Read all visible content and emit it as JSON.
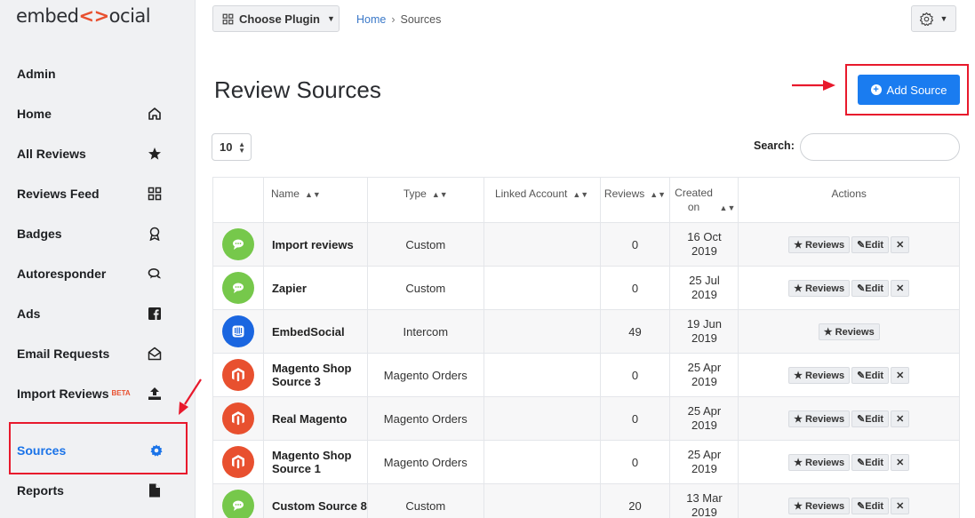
{
  "logo": {
    "left": "embed",
    "bracket": "<>",
    "right": "ocial"
  },
  "sidebar": {
    "items": [
      {
        "label": "Admin",
        "icon": ""
      },
      {
        "label": "Home",
        "icon": "home-icon"
      },
      {
        "label": "All Reviews",
        "icon": "star-icon"
      },
      {
        "label": "Reviews Feed",
        "icon": "grid-icon"
      },
      {
        "label": "Badges",
        "icon": "badge-icon"
      },
      {
        "label": "Autoresponder",
        "icon": "chat-icon"
      },
      {
        "label": "Ads",
        "icon": "facebook-icon"
      },
      {
        "label": "Email Requests",
        "icon": "envelope-icon"
      },
      {
        "label": "Import Reviews",
        "badge": "BETA",
        "icon": "upload-icon"
      },
      {
        "label": "Sources",
        "icon": "gear-icon",
        "active": true
      },
      {
        "label": "Reports",
        "icon": "file-icon"
      }
    ]
  },
  "topbar": {
    "plugin_label": "Choose Plugin",
    "breadcrumb": {
      "home": "Home",
      "sep": "›",
      "current": "Sources"
    }
  },
  "page": {
    "title": "Review Sources"
  },
  "add_button": {
    "label": "Add Source"
  },
  "table_controls": {
    "page_length": "10",
    "search_label": "Search:"
  },
  "table": {
    "headers": [
      "Name",
      "Type",
      "Linked Account",
      "Reviews",
      "Created on",
      "Actions"
    ],
    "rows": [
      {
        "name": "Import reviews",
        "type": "Custom",
        "reviews": "0",
        "created": "16 Oct 2019",
        "avatar": "chat",
        "actions": [
          "Reviews",
          "Edit",
          "delete"
        ]
      },
      {
        "name": "Zapier",
        "type": "Custom",
        "reviews": "0",
        "created": "25 Jul 2019",
        "avatar": "chat",
        "actions": [
          "Reviews",
          "Edit",
          "delete"
        ]
      },
      {
        "name": "EmbedSocial",
        "type": "Intercom",
        "reviews": "49",
        "created": "19 Jun 2019",
        "avatar": "intercom",
        "actions": [
          "Reviews"
        ]
      },
      {
        "name": "Magento Shop Source 3",
        "type": "Magento Orders",
        "reviews": "0",
        "created": "25 Apr 2019",
        "avatar": "magento",
        "actions": [
          "Reviews",
          "Edit",
          "delete"
        ]
      },
      {
        "name": "Real Magento",
        "type": "Magento Orders",
        "reviews": "0",
        "created": "25 Apr 2019",
        "avatar": "magento",
        "actions": [
          "Reviews",
          "Edit",
          "delete"
        ]
      },
      {
        "name": "Magento Shop Source 1",
        "type": "Magento Orders",
        "reviews": "0",
        "created": "25 Apr 2019",
        "avatar": "magento",
        "actions": [
          "Reviews",
          "Edit",
          "delete"
        ]
      },
      {
        "name": "Custom Source 8",
        "type": "Custom",
        "reviews": "20",
        "created": "13 Mar 2019",
        "avatar": "chat",
        "actions": [
          "Reviews",
          "Edit",
          "delete"
        ]
      }
    ]
  },
  "colors": {
    "accent": "#1a7cf0",
    "highlight": "#e8192c",
    "brand": "#e8502f"
  }
}
